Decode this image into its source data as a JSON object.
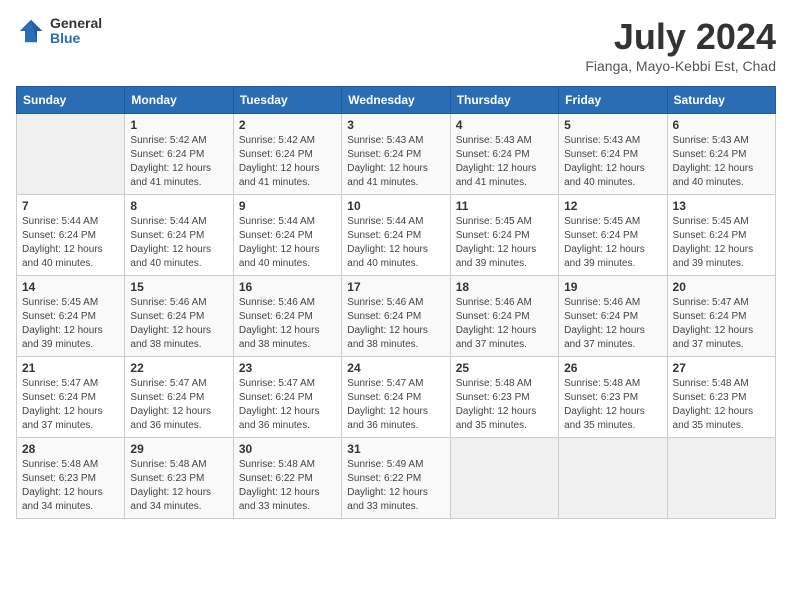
{
  "logo": {
    "general": "General",
    "blue": "Blue"
  },
  "title": "July 2024",
  "subtitle": "Fianga, Mayo-Kebbi Est, Chad",
  "days_of_week": [
    "Sunday",
    "Monday",
    "Tuesday",
    "Wednesday",
    "Thursday",
    "Friday",
    "Saturday"
  ],
  "weeks": [
    [
      {
        "day": "",
        "info": ""
      },
      {
        "day": "1",
        "info": "Sunrise: 5:42 AM\nSunset: 6:24 PM\nDaylight: 12 hours\nand 41 minutes."
      },
      {
        "day": "2",
        "info": "Sunrise: 5:42 AM\nSunset: 6:24 PM\nDaylight: 12 hours\nand 41 minutes."
      },
      {
        "day": "3",
        "info": "Sunrise: 5:43 AM\nSunset: 6:24 PM\nDaylight: 12 hours\nand 41 minutes."
      },
      {
        "day": "4",
        "info": "Sunrise: 5:43 AM\nSunset: 6:24 PM\nDaylight: 12 hours\nand 41 minutes."
      },
      {
        "day": "5",
        "info": "Sunrise: 5:43 AM\nSunset: 6:24 PM\nDaylight: 12 hours\nand 40 minutes."
      },
      {
        "day": "6",
        "info": "Sunrise: 5:43 AM\nSunset: 6:24 PM\nDaylight: 12 hours\nand 40 minutes."
      }
    ],
    [
      {
        "day": "7",
        "info": "Sunrise: 5:44 AM\nSunset: 6:24 PM\nDaylight: 12 hours\nand 40 minutes."
      },
      {
        "day": "8",
        "info": "Sunrise: 5:44 AM\nSunset: 6:24 PM\nDaylight: 12 hours\nand 40 minutes."
      },
      {
        "day": "9",
        "info": "Sunrise: 5:44 AM\nSunset: 6:24 PM\nDaylight: 12 hours\nand 40 minutes."
      },
      {
        "day": "10",
        "info": "Sunrise: 5:44 AM\nSunset: 6:24 PM\nDaylight: 12 hours\nand 40 minutes."
      },
      {
        "day": "11",
        "info": "Sunrise: 5:45 AM\nSunset: 6:24 PM\nDaylight: 12 hours\nand 39 minutes."
      },
      {
        "day": "12",
        "info": "Sunrise: 5:45 AM\nSunset: 6:24 PM\nDaylight: 12 hours\nand 39 minutes."
      },
      {
        "day": "13",
        "info": "Sunrise: 5:45 AM\nSunset: 6:24 PM\nDaylight: 12 hours\nand 39 minutes."
      }
    ],
    [
      {
        "day": "14",
        "info": "Sunrise: 5:45 AM\nSunset: 6:24 PM\nDaylight: 12 hours\nand 39 minutes."
      },
      {
        "day": "15",
        "info": "Sunrise: 5:46 AM\nSunset: 6:24 PM\nDaylight: 12 hours\nand 38 minutes."
      },
      {
        "day": "16",
        "info": "Sunrise: 5:46 AM\nSunset: 6:24 PM\nDaylight: 12 hours\nand 38 minutes."
      },
      {
        "day": "17",
        "info": "Sunrise: 5:46 AM\nSunset: 6:24 PM\nDaylight: 12 hours\nand 38 minutes."
      },
      {
        "day": "18",
        "info": "Sunrise: 5:46 AM\nSunset: 6:24 PM\nDaylight: 12 hours\nand 37 minutes."
      },
      {
        "day": "19",
        "info": "Sunrise: 5:46 AM\nSunset: 6:24 PM\nDaylight: 12 hours\nand 37 minutes."
      },
      {
        "day": "20",
        "info": "Sunrise: 5:47 AM\nSunset: 6:24 PM\nDaylight: 12 hours\nand 37 minutes."
      }
    ],
    [
      {
        "day": "21",
        "info": "Sunrise: 5:47 AM\nSunset: 6:24 PM\nDaylight: 12 hours\nand 37 minutes."
      },
      {
        "day": "22",
        "info": "Sunrise: 5:47 AM\nSunset: 6:24 PM\nDaylight: 12 hours\nand 36 minutes."
      },
      {
        "day": "23",
        "info": "Sunrise: 5:47 AM\nSunset: 6:24 PM\nDaylight: 12 hours\nand 36 minutes."
      },
      {
        "day": "24",
        "info": "Sunrise: 5:47 AM\nSunset: 6:24 PM\nDaylight: 12 hours\nand 36 minutes."
      },
      {
        "day": "25",
        "info": "Sunrise: 5:48 AM\nSunset: 6:23 PM\nDaylight: 12 hours\nand 35 minutes."
      },
      {
        "day": "26",
        "info": "Sunrise: 5:48 AM\nSunset: 6:23 PM\nDaylight: 12 hours\nand 35 minutes."
      },
      {
        "day": "27",
        "info": "Sunrise: 5:48 AM\nSunset: 6:23 PM\nDaylight: 12 hours\nand 35 minutes."
      }
    ],
    [
      {
        "day": "28",
        "info": "Sunrise: 5:48 AM\nSunset: 6:23 PM\nDaylight: 12 hours\nand 34 minutes."
      },
      {
        "day": "29",
        "info": "Sunrise: 5:48 AM\nSunset: 6:23 PM\nDaylight: 12 hours\nand 34 minutes."
      },
      {
        "day": "30",
        "info": "Sunrise: 5:48 AM\nSunset: 6:22 PM\nDaylight: 12 hours\nand 33 minutes."
      },
      {
        "day": "31",
        "info": "Sunrise: 5:49 AM\nSunset: 6:22 PM\nDaylight: 12 hours\nand 33 minutes."
      },
      {
        "day": "",
        "info": ""
      },
      {
        "day": "",
        "info": ""
      },
      {
        "day": "",
        "info": ""
      }
    ]
  ]
}
